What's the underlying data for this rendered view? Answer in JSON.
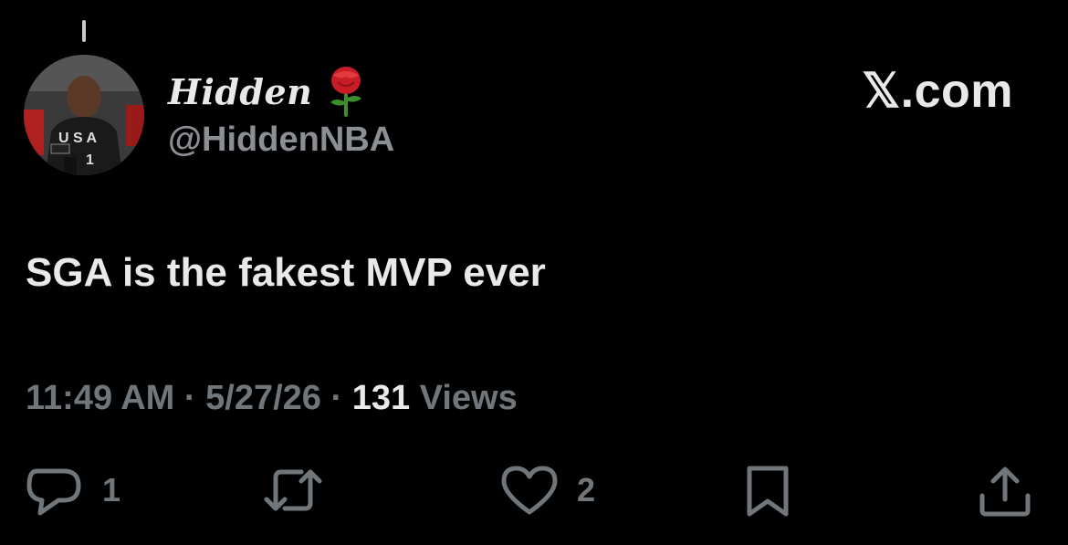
{
  "tweet": {
    "author": {
      "display_name": "Hidden",
      "emoji": "🌹",
      "handle": "@HiddenNBA",
      "avatar_icon": "profile-photo"
    },
    "brand": "𝕏.com",
    "text": "SGA is the fakest MVP ever",
    "time": "11:49 AM",
    "separator": " · ",
    "date": "5/27/26",
    "views_count": "131",
    "views_label": "Views",
    "actions": {
      "reply": {
        "icon": "reply-icon",
        "count": "1"
      },
      "repost": {
        "icon": "repost-icon",
        "count": ""
      },
      "like": {
        "icon": "heart-icon",
        "count": "2"
      },
      "bookmark": {
        "icon": "bookmark-icon",
        "count": ""
      },
      "share": {
        "icon": "share-icon",
        "count": ""
      }
    }
  },
  "colors": {
    "background": "#000000",
    "primary_text": "#e7e9ea",
    "secondary_text": "#71767b"
  }
}
